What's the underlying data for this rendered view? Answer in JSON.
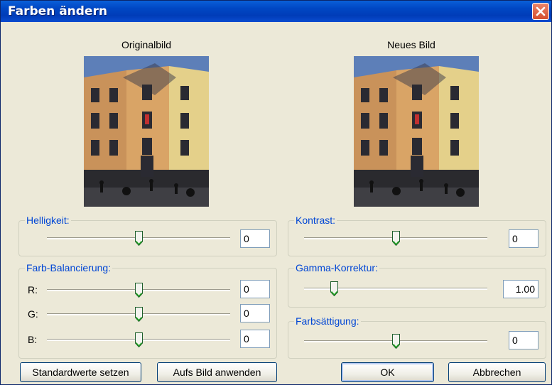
{
  "window": {
    "title": "Farben ändern"
  },
  "preview": {
    "original_label": "Originalbild",
    "new_label": "Neues Bild"
  },
  "brightness": {
    "label": "Helligkeit:",
    "value": "0",
    "level": 0.5
  },
  "contrast": {
    "label": "Kontrast:",
    "value": "0",
    "level": 0.5
  },
  "color_balance": {
    "label": "Farb-Balancierung:",
    "channels": [
      {
        "name": "R:",
        "value": "0",
        "level": 0.5
      },
      {
        "name": "G:",
        "value": "0",
        "level": 0.5
      },
      {
        "name": "B:",
        "value": "0",
        "level": 0.5
      }
    ]
  },
  "gamma": {
    "label": "Gamma-Korrektur:",
    "value": "1.00",
    "level": 0.15
  },
  "saturation": {
    "label": "Farbsättigung:",
    "value": "0",
    "level": 0.5
  },
  "buttons": {
    "defaults": "Standardwerte setzen",
    "apply": "Aufs Bild anwenden",
    "ok": "OK",
    "cancel": "Abbrechen"
  },
  "colors": {
    "titlebar": "#0047c4",
    "group_label": "#0046d5",
    "background": "#ece9d8"
  }
}
